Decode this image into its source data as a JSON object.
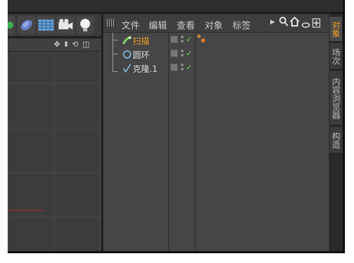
{
  "om_menu": {
    "file": "文件",
    "edit": "编辑",
    "view": "查看",
    "object": "对象",
    "tags": "标签"
  },
  "objects": [
    {
      "name": "扫描",
      "color": "#f0a020",
      "icon": "sweep-nurbs-icon"
    },
    {
      "name": "圆环",
      "color": "#dddddd",
      "icon": "circle-spline-icon"
    },
    {
      "name": "克隆.1",
      "color": "#dddddd",
      "icon": "cloner-icon"
    }
  ],
  "vtabs": {
    "objects": "对象",
    "takes": "场次",
    "content_browser": "内容浏览器",
    "structure": "构造"
  },
  "colors": {
    "accent": "#f0a020",
    "check": "#6ddc50"
  }
}
